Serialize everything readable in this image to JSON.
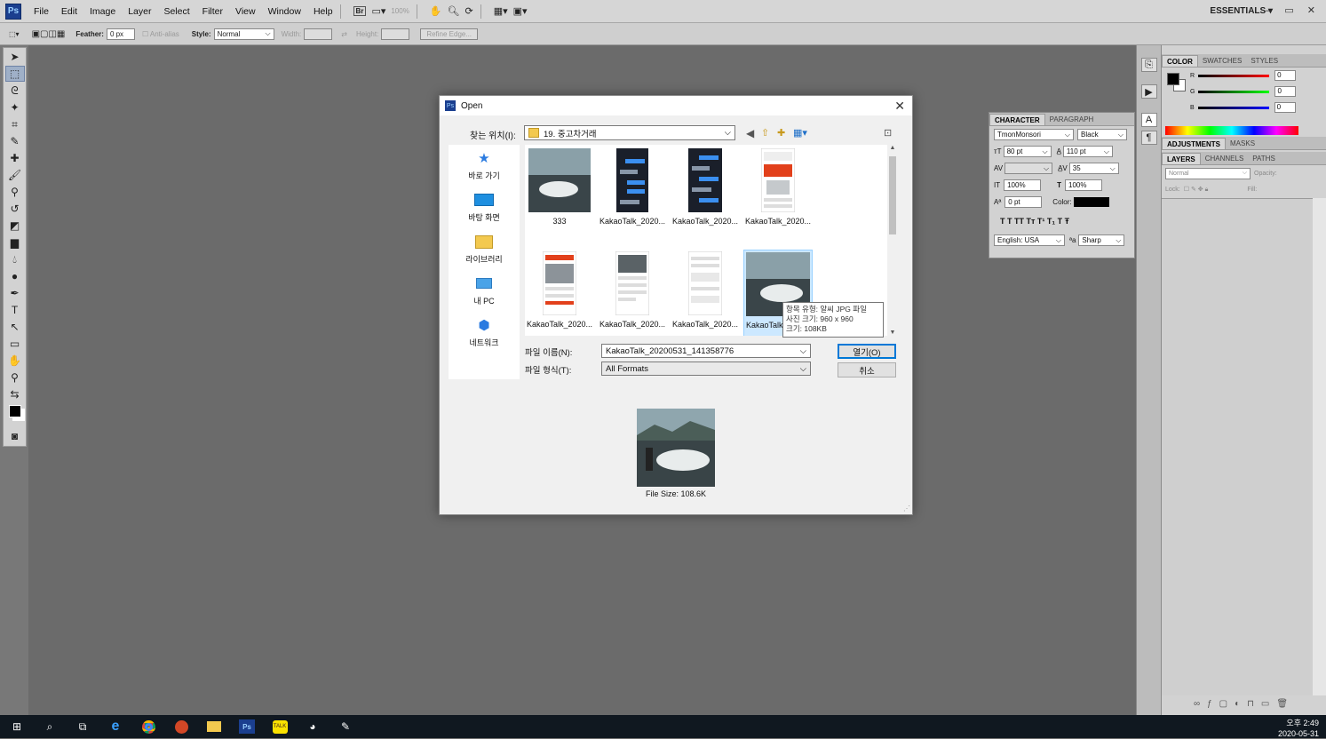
{
  "app": {
    "logo": "Ps"
  },
  "menu": {
    "items": [
      "File",
      "Edit",
      "Image",
      "Layer",
      "Select",
      "Filter",
      "View",
      "Window",
      "Help"
    ],
    "br": "Br",
    "zoom": "100%",
    "essentials": "ESSENTIALS ▾",
    "window_controls": "– ▭ ✕"
  },
  "options": {
    "feather_label": "Feather:",
    "feather_value": "0 px",
    "antialias": "Anti-alias",
    "style_label": "Style:",
    "style_value": "Normal",
    "width_label": "Width:",
    "height_label": "Height:",
    "refine_edge": "Refine Edge..."
  },
  "color_panel": {
    "tabs": [
      "COLOR",
      "SWATCHES",
      "STYLES"
    ],
    "r_label": "R",
    "g_label": "G",
    "b_label": "B",
    "r_value": "0",
    "g_value": "0",
    "b_value": "0",
    "foreground": "#000000",
    "background": "#ffffff"
  },
  "adjust_panel": {
    "tabs": [
      "ADJUSTMENTS",
      "MASKS"
    ]
  },
  "layers_panel": {
    "tabs": [
      "LAYERS",
      "CHANNELS",
      "PATHS"
    ],
    "blend_mode": "Normal",
    "opacity_label": "Opacity:",
    "lock_label": "Lock:",
    "fill_label": "Fill:"
  },
  "character_panel": {
    "tabs": [
      "CHARACTER",
      "PARAGRAPH"
    ],
    "font_family": "TmonMonsori",
    "font_style": "Black",
    "font_size": "80 pt",
    "leading": "110 pt",
    "kerning": "",
    "tracking": "35",
    "vscale": "100%",
    "hscale": "100%",
    "baseline": "0 pt",
    "color_label": "Color:",
    "style_buttons": "T  T  TT  Tт  T¹  T₁  T  Ŧ",
    "language": "English: USA",
    "aa_label": "ªa",
    "antialias": "Sharp"
  },
  "dialog": {
    "title": "Open",
    "lookin_label": "찾는 위치(I):",
    "lookin_value": "19. 중고차거래",
    "places": [
      {
        "label": "바로 가기",
        "icon": "star-icon"
      },
      {
        "label": "바탕 화면",
        "icon": "desktop-icon"
      },
      {
        "label": "라이브러리",
        "icon": "library-icon"
      },
      {
        "label": "내 PC",
        "icon": "pc-icon"
      },
      {
        "label": "네트워크",
        "icon": "network-icon"
      }
    ],
    "files": [
      {
        "label": "333"
      },
      {
        "label": "KakaoTalk_2020..."
      },
      {
        "label": "KakaoTalk_2020..."
      },
      {
        "label": "KakaoTalk_2020..."
      },
      {
        "label": "KakaoTalk_2020..."
      },
      {
        "label": "KakaoTalk_2020..."
      },
      {
        "label": "KakaoTalk_2020..."
      },
      {
        "label": "KakaoTalk_2020..."
      }
    ],
    "tooltip": {
      "line1": "항목 유형: 알씨 JPG 파일",
      "line2": "사진 크기: 960 x 960",
      "line3": "크기: 108KB"
    },
    "filename_label": "파일 이름(N):",
    "filename_value": "KakaoTalk_20200531_141358776",
    "filetype_label": "파일 형식(T):",
    "filetype_value": "All Formats",
    "open_button": "열기(O)",
    "cancel_button": "취소",
    "file_size": "File Size: 108.6K"
  },
  "taskbar": {
    "time": "오후 2:49",
    "date": "2020-05-31"
  }
}
